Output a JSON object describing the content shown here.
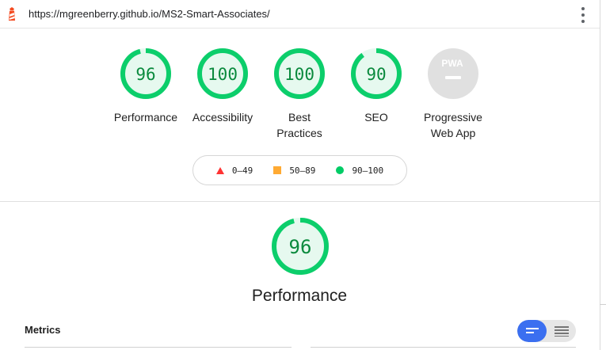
{
  "url": "https://mgreenberry.github.io/MS2-Smart-Associates/",
  "categories": [
    {
      "id": "performance",
      "score": "96",
      "score_value": 96,
      "label": "Performance"
    },
    {
      "id": "accessibility",
      "score": "100",
      "score_value": 100,
      "label": "Accessibility"
    },
    {
      "id": "best-practices",
      "score": "100",
      "score_value": 100,
      "label_line1": "Best",
      "label_line2": "Practices"
    },
    {
      "id": "seo",
      "score": "90",
      "score_value": 90,
      "label": "SEO"
    },
    {
      "id": "pwa",
      "badge": "PWA",
      "label_line1": "Progressive",
      "label_line2": "Web App"
    }
  ],
  "legend": {
    "fail": "0–49",
    "average": "50–89",
    "pass": "90–100"
  },
  "section": {
    "score": "96",
    "score_value": 96,
    "title": "Performance",
    "metrics_title": "Metrics"
  },
  "colors": {
    "pass": "#0cce6b",
    "pass_text": "#0a8a3d",
    "average": "#ffaa33",
    "fail": "#ff3333",
    "toggle_active": "#3b6ff0"
  },
  "icons": {
    "logo": "lighthouse-icon",
    "menu": "kebab-menu-icon",
    "view_list": "list-view-icon",
    "view_table": "table-view-icon"
  }
}
